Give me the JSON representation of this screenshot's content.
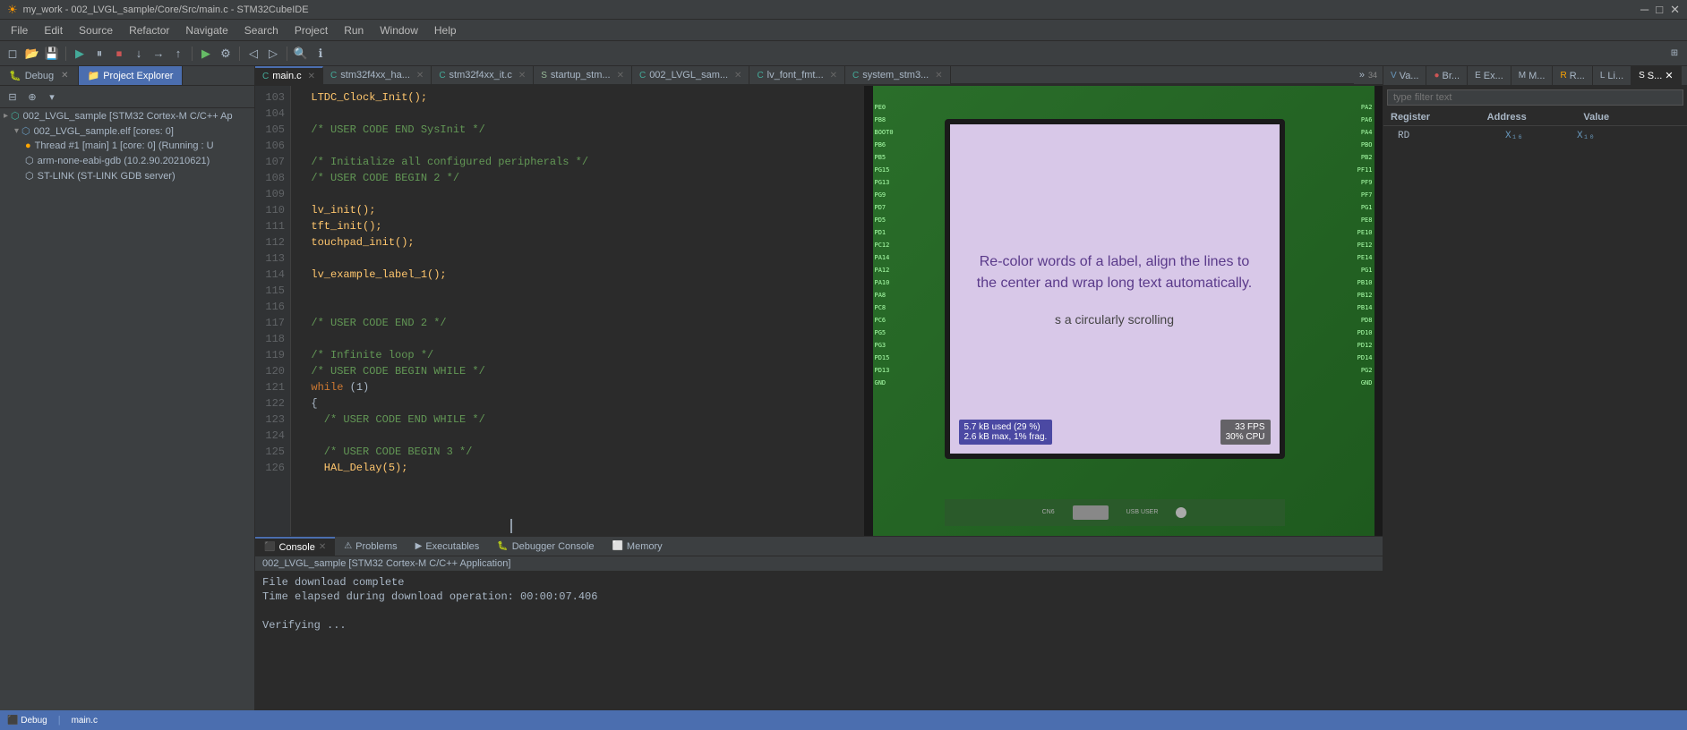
{
  "titlebar": {
    "title": "my_work - 002_LVGL_sample/Core/Src/main.c - STM32CubeIDE",
    "icon": "eclipse-icon",
    "minimize": "─",
    "maximize": "□",
    "close": "✕"
  },
  "menubar": {
    "items": [
      "File",
      "Edit",
      "Source",
      "Refactor",
      "Navigate",
      "Search",
      "Project",
      "Run",
      "Window",
      "Help"
    ]
  },
  "left_tabs": [
    {
      "label": "Debug",
      "active": false,
      "closable": true
    },
    {
      "label": "Project Explorer",
      "active": true,
      "closable": false
    }
  ],
  "tree": {
    "items": [
      {
        "indent": 0,
        "icon": "▸",
        "label": "002_LVGL_sample [STM32 Cortex-M C/C++ Ap",
        "type": "project"
      },
      {
        "indent": 1,
        "icon": "▾",
        "label": "002_LVGL_sample.elf [cores: 0]",
        "type": "elf"
      },
      {
        "indent": 2,
        "icon": "●",
        "label": "Thread #1 [main] 1 [core: 0] (Running : U",
        "type": "thread"
      },
      {
        "indent": 2,
        "icon": "⬡",
        "label": "arm-none-eabi-gdb (10.2.90.20210621)",
        "type": "gdb"
      },
      {
        "indent": 2,
        "icon": "⬡",
        "label": "ST-LINK (ST-LINK GDB server)",
        "type": "stlink"
      }
    ]
  },
  "editor_tabs": [
    {
      "label": "main.c",
      "active": true,
      "dirty": false,
      "closable": true
    },
    {
      "label": "stm32f4xx_ha...",
      "active": false,
      "dirty": false,
      "closable": true
    },
    {
      "label": "stm32f4xx_it.c",
      "active": false,
      "dirty": false,
      "closable": true
    },
    {
      "label": "startup_stm...",
      "active": false,
      "dirty": false,
      "closable": true
    },
    {
      "label": "002_LVGL_sam...",
      "active": false,
      "dirty": false,
      "closable": true
    },
    {
      "label": "lv_font_fmt...",
      "active": false,
      "dirty": false,
      "closable": true
    },
    {
      "label": "system_stm3...",
      "active": false,
      "dirty": false,
      "closable": true
    }
  ],
  "code": {
    "lines": [
      {
        "num": "103",
        "content": "  LTDC_Clock_Init();",
        "type": "normal"
      },
      {
        "num": "104",
        "content": "",
        "type": "normal"
      },
      {
        "num": "105",
        "content": "  /* USER CODE END SysInit */",
        "type": "comment"
      },
      {
        "num": "106",
        "content": "",
        "type": "normal"
      },
      {
        "num": "107",
        "content": "  /* Initialize all configured peripherals */",
        "type": "comment"
      },
      {
        "num": "108",
        "content": "  /* USER CODE BEGIN 2 */",
        "type": "comment"
      },
      {
        "num": "109",
        "content": "",
        "type": "normal"
      },
      {
        "num": "110",
        "content": "  lv_init();",
        "type": "function"
      },
      {
        "num": "111",
        "content": "  tft_init();",
        "type": "function"
      },
      {
        "num": "112",
        "content": "  touchpad_init();",
        "type": "function"
      },
      {
        "num": "113",
        "content": "",
        "type": "normal"
      },
      {
        "num": "114",
        "content": "  lv_example_label_1();",
        "type": "function"
      },
      {
        "num": "115",
        "content": "",
        "type": "normal"
      },
      {
        "num": "116",
        "content": "",
        "type": "normal"
      },
      {
        "num": "117",
        "content": "  /* USER CODE END 2 */",
        "type": "comment"
      },
      {
        "num": "118",
        "content": "",
        "type": "normal"
      },
      {
        "num": "119",
        "content": "  /* Infinite loop */",
        "type": "comment"
      },
      {
        "num": "120",
        "content": "  /* USER CODE BEGIN WHILE */",
        "type": "comment"
      },
      {
        "num": "121",
        "content": "  while (1)",
        "type": "keyword"
      },
      {
        "num": "122",
        "content": "  {",
        "type": "normal"
      },
      {
        "num": "123",
        "content": "    /* USER CODE END WHILE */",
        "type": "comment"
      },
      {
        "num": "124",
        "content": "",
        "type": "normal"
      },
      {
        "num": "125",
        "content": "    /* USER CODE BEGIN 3 */",
        "type": "comment"
      },
      {
        "num": "126",
        "content": "    HAL_Delay(5);",
        "type": "function"
      }
    ]
  },
  "bottom_tabs": [
    {
      "label": "Console",
      "active": true,
      "closable": true,
      "icon": "console-icon"
    },
    {
      "label": "Problems",
      "active": false,
      "closable": false,
      "icon": "problems-icon"
    },
    {
      "label": "Executables",
      "active": false,
      "closable": false,
      "icon": "exec-icon"
    },
    {
      "label": "Debugger Console",
      "active": false,
      "closable": false,
      "icon": "debug-icon"
    },
    {
      "label": "Memory",
      "active": false,
      "closable": false,
      "icon": "memory-icon"
    }
  ],
  "console": {
    "label": "002_LVGL_sample [STM32 Cortex-M C/C++ Application]",
    "lines": [
      "File download complete",
      "Time elapsed during download operation: 00:00:07.406",
      "",
      "Verifying ..."
    ]
  },
  "right_tabs": [
    {
      "label": "Va...",
      "active": false
    },
    {
      "label": "Br...",
      "active": false
    },
    {
      "label": "Ex...",
      "active": false
    },
    {
      "label": "M...",
      "active": false
    },
    {
      "label": "R...",
      "active": false
    },
    {
      "label": "Li...",
      "active": false
    },
    {
      "label": "S...",
      "active": true
    }
  ],
  "registers": {
    "filter_placeholder": "type filter text",
    "headers": [
      "Register",
      "Address",
      "Value"
    ],
    "rows": [
      {
        "name": "RD",
        "addr": "",
        "val": "X₁₆",
        "val2": "X₁₀"
      }
    ]
  },
  "device": {
    "screen_text": "Re-color words of a label, align the lines to the center and wrap long text automatically.",
    "scroll_text": "s a circularly scrolling",
    "stats_left": "5.7 kB used (29 %)\n2.6 kB max, 1% frag.",
    "stats_right": "33 FPS\n30% CPU"
  },
  "statusbar": {
    "items": []
  },
  "toolbar_icons": [
    "⬅",
    "⬅⬅",
    "▶",
    "⏸",
    "⏹",
    "◼",
    "⬛",
    "▪",
    "⬅",
    "➡",
    "➡➡",
    "⏏",
    "⏫",
    "⏬",
    "🔍",
    "⚙",
    "ℹ"
  ]
}
